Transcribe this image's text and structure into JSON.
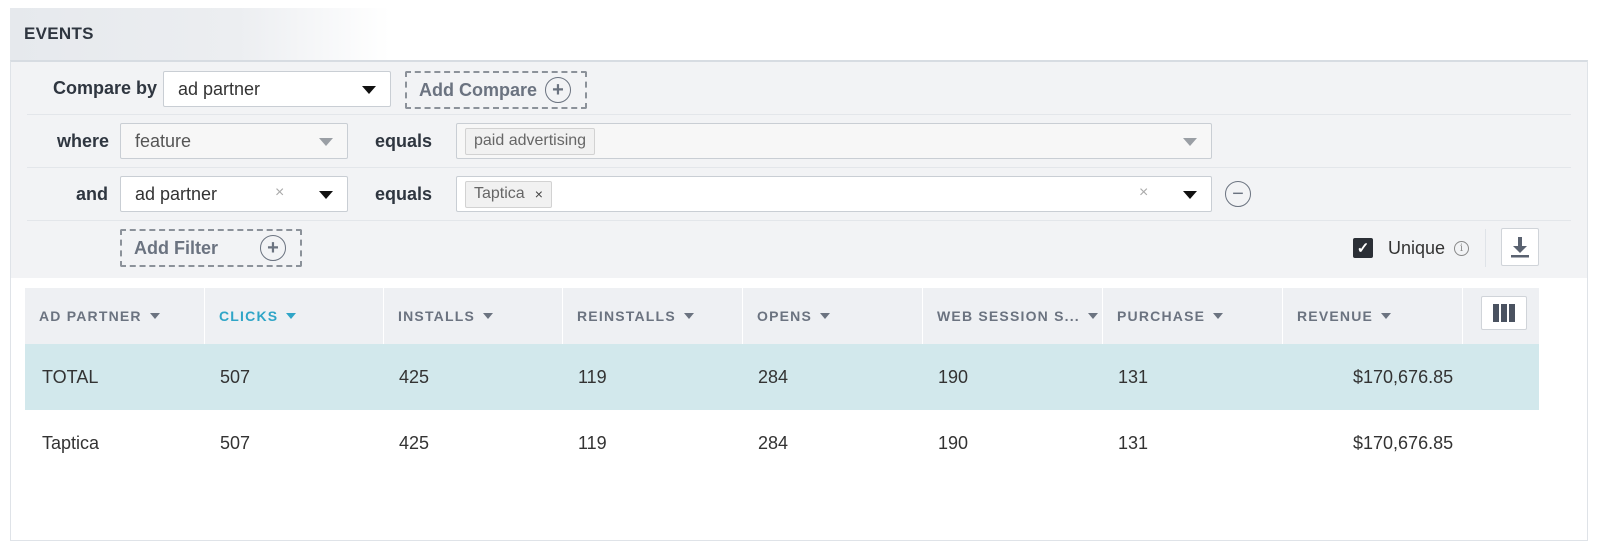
{
  "section": {
    "title": "EVENTS"
  },
  "compare": {
    "label": "Compare by",
    "value": "ad partner",
    "add_label": "Add Compare"
  },
  "filters": [
    {
      "connector": "where",
      "field": "feature",
      "operator": "equals",
      "values": [
        "paid advertising"
      ],
      "removable": false
    },
    {
      "connector": "and",
      "field": "ad partner",
      "operator": "equals",
      "values": [
        "Taptica"
      ],
      "removable": true
    }
  ],
  "add_filter_label": "Add Filter",
  "unique": {
    "label": "Unique",
    "checked": true
  },
  "table": {
    "columns": [
      {
        "label": "AD PARTNER",
        "active": false
      },
      {
        "label": "CLICKS",
        "active": true
      },
      {
        "label": "INSTALLS",
        "active": false
      },
      {
        "label": "REINSTALLS",
        "active": false
      },
      {
        "label": "OPENS",
        "active": false
      },
      {
        "label": "WEB SESSION S...",
        "active": false
      },
      {
        "label": "PURCHASE",
        "active": false
      },
      {
        "label": "REVENUE",
        "active": false
      }
    ],
    "rows": [
      {
        "name": "TOTAL",
        "clicks": "507",
        "installs": "425",
        "reinstalls": "119",
        "opens": "284",
        "web_sessions": "190",
        "purchase": "131",
        "revenue": "$170,676.85"
      },
      {
        "name": "Taptica",
        "clicks": "507",
        "installs": "425",
        "reinstalls": "119",
        "opens": "284",
        "web_sessions": "190",
        "purchase": "131",
        "revenue": "$170,676.85"
      }
    ]
  },
  "colors": {
    "accent": "#2fa5c7",
    "total_row": "#d2e8ec",
    "filter_bg": "#f2f3f5"
  }
}
